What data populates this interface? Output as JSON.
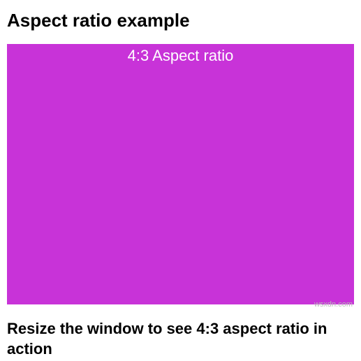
{
  "title": "Aspect ratio example",
  "box": {
    "label": "4:3 Aspect ratio",
    "color": "#c833d8"
  },
  "caption": "Resize the window to see 4:3 aspect ratio in action",
  "watermark": "wsxdn.com"
}
